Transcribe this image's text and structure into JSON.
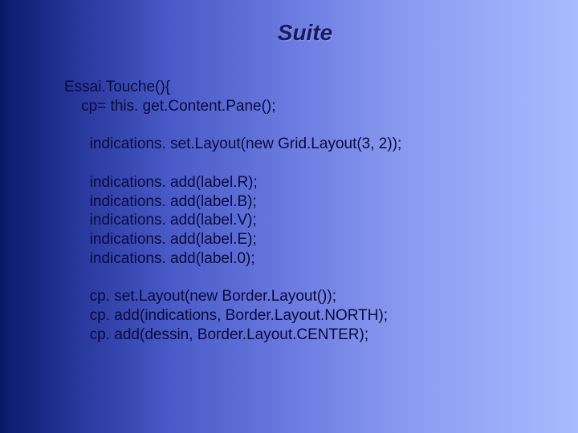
{
  "title": "Suite",
  "code": {
    "line1": "Essai.Touche(){",
    "line2": "    cp= this. get.Content.Pane();",
    "line3": "",
    "line4": "      indications. set.Layout(new Grid.Layout(3, 2));",
    "line5": "",
    "line6": "      indications. add(label.R);",
    "line7": "      indications. add(label.B);",
    "line8": "      indications. add(label.V);",
    "line9": "      indications. add(label.E);",
    "line10": "      indications. add(label.0);",
    "line11": "",
    "line12": "      cp. set.Layout(new Border.Layout());",
    "line13": "      cp. add(indications, Border.Layout.NORTH);",
    "line14": "      cp. add(dessin, Border.Layout.CENTER);"
  }
}
